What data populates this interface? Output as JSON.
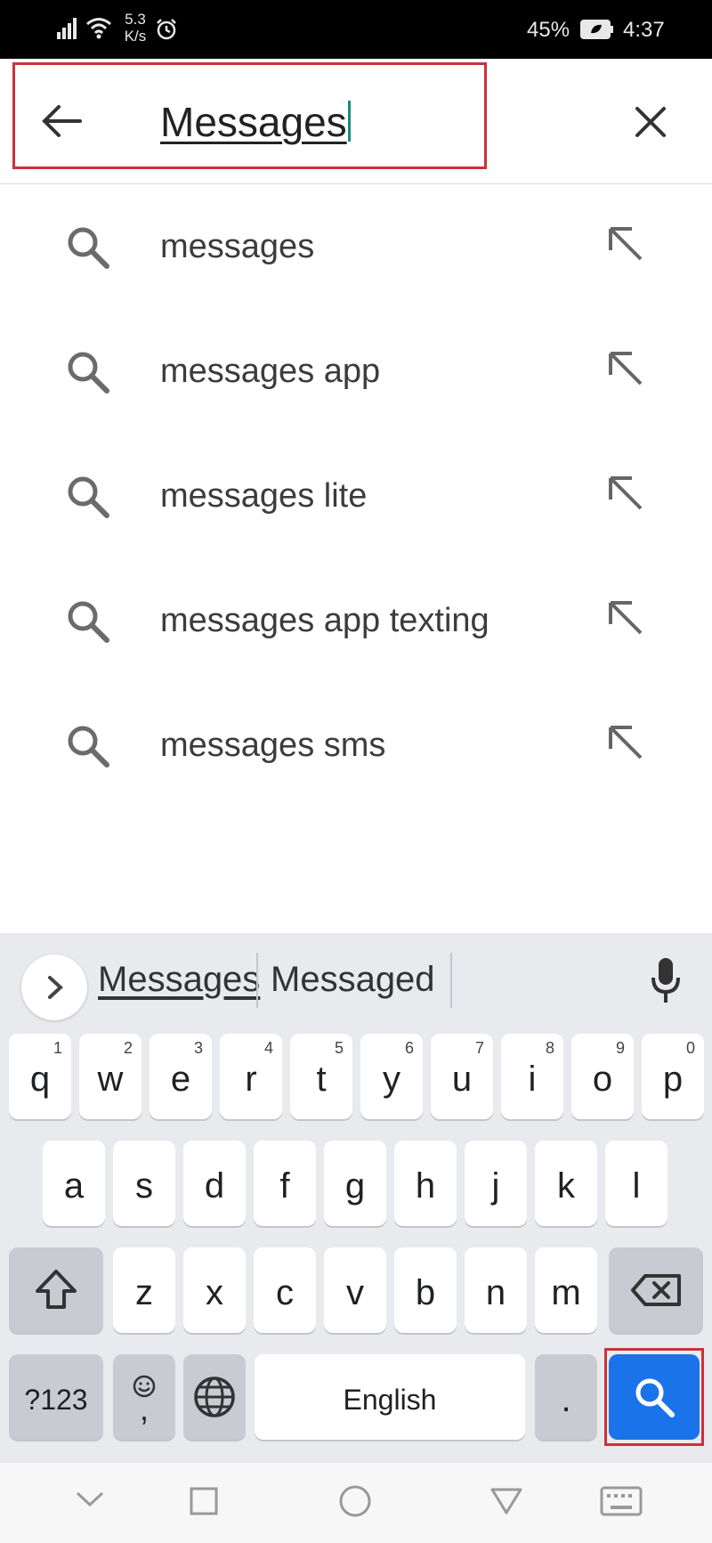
{
  "status_bar": {
    "net_speed_value": "5.3",
    "net_speed_unit": "K/s",
    "battery": "45%",
    "time": "4:37"
  },
  "search": {
    "query": "Messages"
  },
  "suggestions": [
    {
      "label": "messages"
    },
    {
      "label": "messages app"
    },
    {
      "label": "messages lite"
    },
    {
      "label": "messages app texting"
    },
    {
      "label": "messages sms"
    }
  ],
  "keyboard": {
    "candidates": [
      "Messages",
      "Messaged"
    ],
    "row1": [
      {
        "k": "q",
        "h": "1"
      },
      {
        "k": "w",
        "h": "2"
      },
      {
        "k": "e",
        "h": "3"
      },
      {
        "k": "r",
        "h": "4"
      },
      {
        "k": "t",
        "h": "5"
      },
      {
        "k": "y",
        "h": "6"
      },
      {
        "k": "u",
        "h": "7"
      },
      {
        "k": "i",
        "h": "8"
      },
      {
        "k": "o",
        "h": "9"
      },
      {
        "k": "p",
        "h": "0"
      }
    ],
    "row2": [
      "a",
      "s",
      "d",
      "f",
      "g",
      "h",
      "j",
      "k",
      "l"
    ],
    "row3": [
      "z",
      "x",
      "c",
      "v",
      "b",
      "n",
      "m"
    ],
    "symbols_label": "?123",
    "emoji_comma_label": ",",
    "space_label": "English",
    "period_label": "."
  },
  "colors": {
    "highlight_box": "#c8323a",
    "search_key": "#1a73e8",
    "caret": "#1a8a7a"
  }
}
